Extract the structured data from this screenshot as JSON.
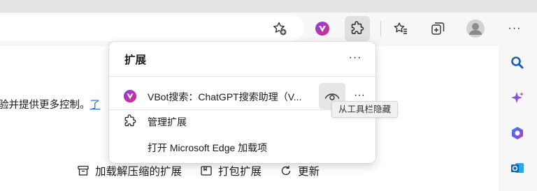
{
  "toolbar": {
    "icons": [
      "favorite-add-icon",
      "vbot-extension-icon",
      "extensions-icon",
      "favorites-icon",
      "collections-icon",
      "profile-avatar",
      "more-icon"
    ]
  },
  "popup": {
    "title": "扩展",
    "more_label": "···",
    "extension": {
      "name": "VBot搜索：ChatGPT搜索助理（V...",
      "more_label": "···"
    },
    "manage_label": "管理扩展",
    "open_label": "打开 Microsoft Edge 加载项"
  },
  "tooltip": "从工具栏隐藏",
  "page": {
    "text": "验并提供更多控制。",
    "link_fragment": "了",
    "actions": [
      "加载解压缩的扩展",
      "打包扩展",
      "更新"
    ]
  },
  "sidebar": {
    "icons": [
      "search-icon",
      "copilot-icon",
      "office-icon",
      "outlook-icon"
    ]
  },
  "colors": {
    "accent": "#0f6cbd",
    "vbot_purple": "#6b2fd6"
  }
}
